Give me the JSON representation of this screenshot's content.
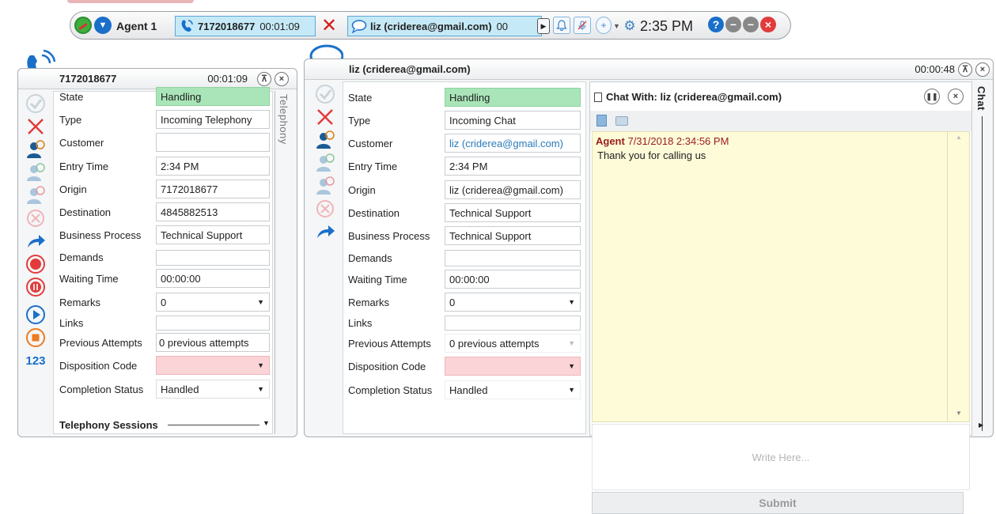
{
  "toolbar": {
    "agent_name": "Agent 1",
    "telephony_session": {
      "number": "7172018677",
      "timer": "00:01:09"
    },
    "chat_session": {
      "name": "liz (criderea@gmail.com)",
      "timer": "00"
    },
    "clock": "2:35 PM",
    "help": "?"
  },
  "telephony": {
    "title": "7172018677",
    "timer": "00:01:09",
    "side_label": "Telephony",
    "counter_label": "123",
    "sessions_label": "Telephony Sessions",
    "fields": [
      {
        "label": "State",
        "value": "Handling"
      },
      {
        "label": "Type",
        "value": "Incoming Telephony"
      },
      {
        "label": "Customer",
        "value": ""
      },
      {
        "label": "Entry Time",
        "value": "2:34 PM"
      },
      {
        "label": "Origin",
        "value": "7172018677"
      },
      {
        "label": "Destination",
        "value": "4845882513"
      },
      {
        "label": "Business Process",
        "value": "Technical Support"
      },
      {
        "label": "Demands",
        "value": ""
      },
      {
        "label": "Waiting Time",
        "value": "00:00:00"
      },
      {
        "label": "Remarks",
        "value": "0"
      },
      {
        "label": "Links",
        "value": ""
      },
      {
        "label": "Previous Attempts",
        "value": "0 previous attempts"
      },
      {
        "label": "Disposition Code",
        "value": ""
      },
      {
        "label": "Completion Status",
        "value": "Handled"
      }
    ]
  },
  "chat": {
    "title": "liz (criderea@gmail.com)",
    "timer": "00:00:48",
    "side_label": "Chat",
    "chat_with": "Chat With: liz (criderea@gmail.com)",
    "fields": [
      {
        "label": "State",
        "value": "Handling"
      },
      {
        "label": "Type",
        "value": "Incoming Chat"
      },
      {
        "label": "Customer",
        "value": "liz (criderea@gmail.com)"
      },
      {
        "label": "Entry Time",
        "value": "2:34 PM"
      },
      {
        "label": "Origin",
        "value": "liz (criderea@gmail.com)"
      },
      {
        "label": "Destination",
        "value": "Technical Support"
      },
      {
        "label": "Business Process",
        "value": "Technical Support"
      },
      {
        "label": "Demands",
        "value": ""
      },
      {
        "label": "Waiting Time",
        "value": "00:00:00"
      },
      {
        "label": "Remarks",
        "value": "0"
      },
      {
        "label": "Links",
        "value": ""
      },
      {
        "label": "Previous Attempts",
        "value": "0 previous attempts"
      },
      {
        "label": "Disposition Code",
        "value": ""
      },
      {
        "label": "Completion Status",
        "value": "Handled"
      }
    ],
    "transcript": [
      {
        "sender": "Agent",
        "timestamp": "7/31/2018 2:34:56 PM",
        "text": "Thank you for calling us"
      }
    ],
    "compose_placeholder": "Write Here...",
    "submit_label": "Submit"
  },
  "colors": {
    "handling_green": "#a9e5b8",
    "disposition_pink": "#fbd4d7",
    "session_blue": "#c6e9f7",
    "transcript_yellow": "#fdfbd8",
    "agent_name_red": "#9b1c1c"
  }
}
